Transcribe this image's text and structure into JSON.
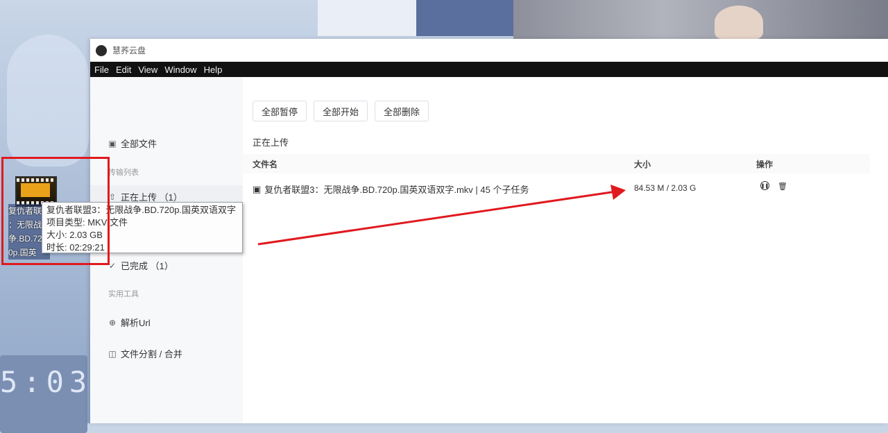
{
  "desktop": {
    "clock_text": "5:03",
    "icon_label_lines": [
      "复仇者联盟3",
      "：无限战",
      "争.BD.72",
      "0p.国英"
    ],
    "tooltip": [
      "复仇者联盟3：无限战争.BD.720p.国英双语双字",
      "项目类型: MKV 文件",
      "大小: 2.03 GB",
      "时长: 02:29:21"
    ]
  },
  "window": {
    "title": "慧荞云盘",
    "menu": [
      "File",
      "Edit",
      "View",
      "Window",
      "Help"
    ]
  },
  "sidebar": {
    "all_files": "全部文件",
    "transfer_section": "传输列表",
    "uploading": "正在上传  （1）",
    "completed": "已完成  （1）",
    "tools_section": "实用工具",
    "parse_url": "解析Url",
    "split_merge": "文件分割 / 合并"
  },
  "toolbar": {
    "pause_all": "全部暂停",
    "start_all": "全部开始",
    "delete_all": "全部删除"
  },
  "main": {
    "section_title": "正在上传",
    "columns": {
      "name": "文件名",
      "size": "大小",
      "actions": "操作"
    },
    "rows": [
      {
        "name": "复仇者联盟3：无限战争.BD.720p.国英双语双字.mkv | 45 个子任务",
        "size": "84.53 M / 2.03 G"
      }
    ]
  },
  "colors": {
    "highlight": "#e0191e",
    "menubar": "#111111"
  },
  "icons": {
    "file": "file-icon",
    "pause": "pause-icon",
    "delete": "trash-icon"
  }
}
